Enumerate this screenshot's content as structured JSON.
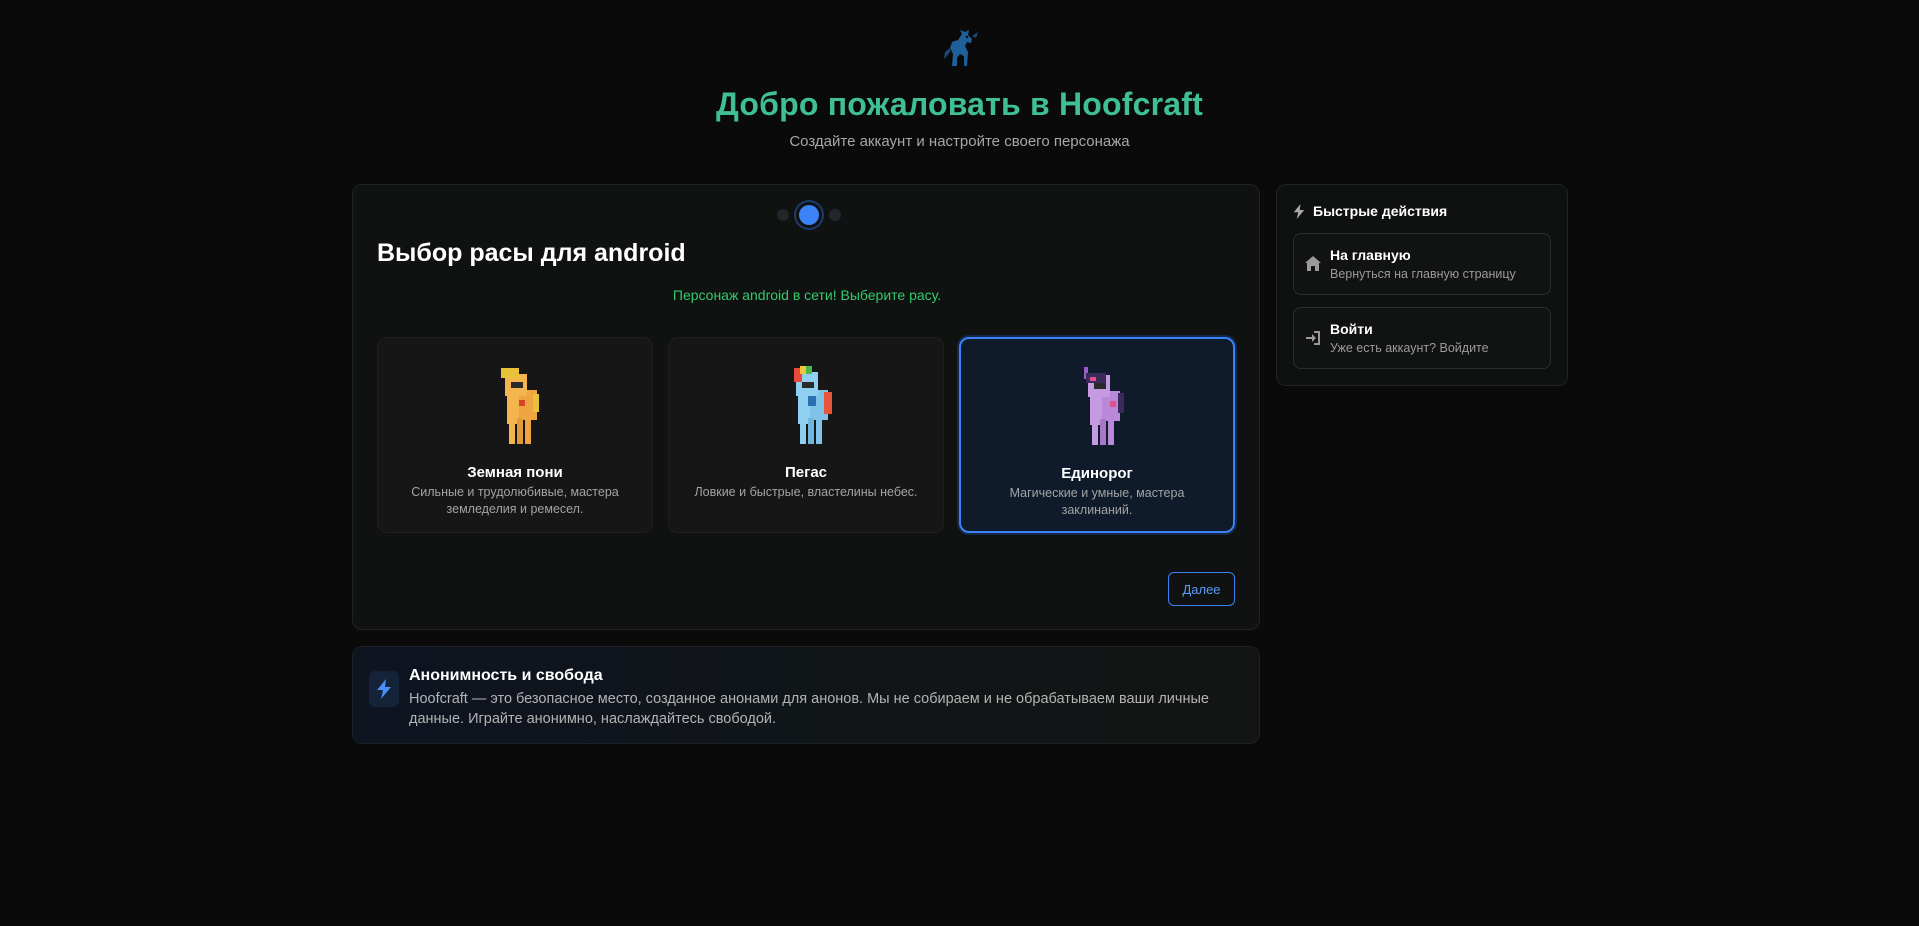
{
  "header": {
    "logo_icon": "pony-logo-icon",
    "title": "Добро пожаловать в Hoofcraft",
    "subtitle": "Создайте аккаунт и настройте своего персонажа"
  },
  "wizard": {
    "steps_total": 3,
    "current_step": 2,
    "section_title": "Выбор расы для android",
    "status_text": "Персонаж android в сети! Выберите расу.",
    "races": [
      {
        "name": "Земная пони",
        "description": "Сильные и трудолюбивые, мастера земледелия и ремесел.",
        "selected": false,
        "icon": "earth-pony-icon"
      },
      {
        "name": "Пегас",
        "description": "Ловкие и быстрые, властелины небес.",
        "selected": false,
        "icon": "pegasus-icon"
      },
      {
        "name": "Единорог",
        "description": "Магические и умные, мастера заклинаний.",
        "selected": true,
        "icon": "unicorn-icon"
      }
    ],
    "next_label": "Далее"
  },
  "info": {
    "icon": "lightning-icon",
    "title": "Анонимность и свобода",
    "text": "Hoofcraft — это безопасное место, созданное анонами для анонов. Мы не собираем и не обрабатываем ваши личные данные. Играйте анонимно, наслаждайтесь свободой."
  },
  "quick_actions": {
    "title": "Быстрые действия",
    "icon": "lightning-icon",
    "items": [
      {
        "label": "На главную",
        "sublabel": "Вернуться на главную страницу",
        "icon": "home-icon"
      },
      {
        "label": "Войти",
        "sublabel": "Уже есть аккаунт? Войдите",
        "icon": "login-icon"
      }
    ]
  },
  "colors": {
    "accent": "#3b82f6",
    "title_green": "#3fbf94",
    "status_green": "#34c96c",
    "background": "#0a0a0b"
  }
}
